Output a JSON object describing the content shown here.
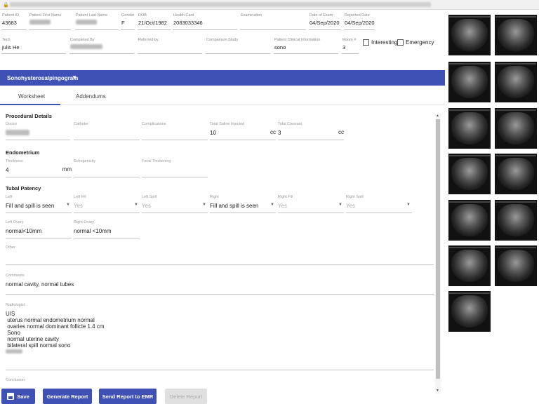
{
  "header": {
    "patient_id": {
      "label": "Patient ID",
      "value": "43683"
    },
    "first_name": {
      "label": "Patient First Name"
    },
    "last_name": {
      "label": "Patient Last Name"
    },
    "gender": {
      "label": "Gender",
      "value": "F"
    },
    "dob": {
      "label": "DOB",
      "value": "21/Oct/1982"
    },
    "health_card": {
      "label": "Health Card",
      "value": "2083033346"
    },
    "examination": {
      "label": "Examination"
    },
    "date_of_exam": {
      "label": "Date of Exam",
      "value": "04/Sep/2020"
    },
    "reported_date": {
      "label": "Reported Date",
      "value": "04/Sep/2020"
    },
    "tech": {
      "label": "Tech",
      "value": "julis He"
    },
    "completed_by": {
      "label": "Completed By"
    },
    "referred_by": {
      "label": "Referred by"
    },
    "comparison_study": {
      "label": "Comparison Study"
    },
    "patient_clinical_info": {
      "label": "Patient Clinical Information",
      "value": "sono"
    },
    "room": {
      "label": "Room #",
      "value": "3"
    },
    "interesting_label": "Interesting",
    "emergency_label": "Emergency"
  },
  "exam_bar": {
    "title": "Sonohysterosalpingogram"
  },
  "tabs": [
    {
      "label": "Worksheet",
      "active": true
    },
    {
      "label": "Addendums",
      "active": false
    }
  ],
  "form": {
    "procedural_details": {
      "heading": "Procedural Details",
      "doctor": {
        "label": "Doctor"
      },
      "catheter": {
        "label": "Catheter",
        "value": ""
      },
      "complications": {
        "label": "Complications",
        "value": ""
      },
      "total_saline": {
        "label": "Total Saline Injected",
        "value": "10",
        "unit": "cc"
      },
      "total_contrast": {
        "label": "Total Contrast",
        "value": "3",
        "unit": "cc"
      }
    },
    "endometrium": {
      "heading": "Endometrium",
      "thickness": {
        "label": "Thickness",
        "value": "4",
        "unit": "mm"
      },
      "echogenicity": {
        "label": "Echogenicity",
        "value": ""
      },
      "focal_thickening": {
        "label": "Focal Thickening",
        "value": ""
      }
    },
    "tubal_patency": {
      "heading": "Tubal Patency",
      "left": {
        "label": "Left",
        "value": "Fill and spill is seen"
      },
      "left_fill": {
        "label": "Left Fill",
        "value": "Yes"
      },
      "left_spill": {
        "label": "Left Spill",
        "value": "Yes"
      },
      "right": {
        "label": "Right",
        "value": "Fill and spill is seen"
      },
      "right_fill": {
        "label": "Right Fill",
        "value": "Yes"
      },
      "right_spill": {
        "label": "Right Spill",
        "value": "Yes"
      },
      "left_ovary": {
        "label": "Left Ovary",
        "value": "normal<10mm"
      },
      "right_ovary": {
        "label": "Right Ovary",
        "value": "normal <10mm"
      }
    },
    "other": {
      "label": "Other",
      "value": ""
    },
    "comments": {
      "label": "Comments",
      "value": "normal cavity, normal tubes"
    },
    "radiologist": {
      "label": "Radiologist",
      "lines": [
        "U/S",
        " uterus normal endometrium normal",
        " ovaries normal dominant follicle 1.4 cm",
        " Sono",
        " normal uterine cavity",
        " bilateral spill normal sono"
      ]
    },
    "conclusion": {
      "label": "Conclusion",
      "value": ""
    }
  },
  "buttons": {
    "save": "Save",
    "generate_report": "Generate Report",
    "send_to_emr": "Send Report to EMR",
    "delete_report": "Delete Report"
  },
  "colors": {
    "accent": "#3f51b5",
    "disabled": "#e0e0e0"
  },
  "thumbnails": {
    "count": 13,
    "icon": "ultrasound-image"
  }
}
